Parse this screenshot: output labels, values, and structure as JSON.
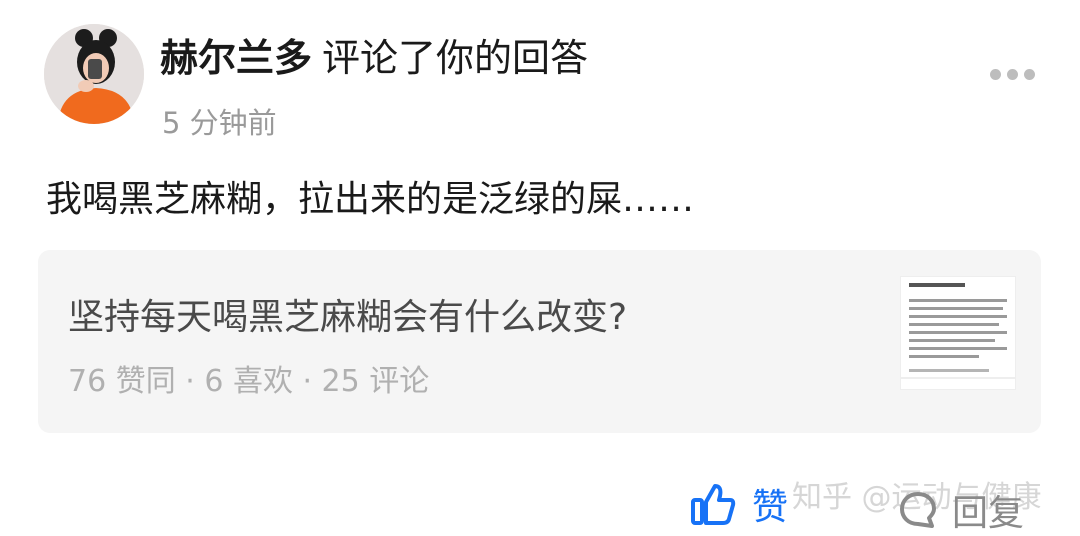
{
  "notification": {
    "user_name": "赫尔兰多",
    "action": "评论了你的回答",
    "time": "5 分钟前",
    "comment": "我喝黑芝麻糊，拉出来的是泛绿的屎……"
  },
  "card": {
    "question": "坚持每天喝黑芝麻糊会有什么改变?",
    "stats": "76 赞同 · 6 喜欢 · 25 评论"
  },
  "actions": {
    "like_label": "赞",
    "reply_label": "回复"
  },
  "watermark": "知乎 @运动与健康",
  "colors": {
    "accent": "#1772f6",
    "card_bg": "#f5f5f5",
    "muted_text": "#9a9a9a"
  },
  "icons": {
    "more": "more-horizontal-icon",
    "like": "thumbs-up-icon",
    "reply": "comment-icon"
  }
}
